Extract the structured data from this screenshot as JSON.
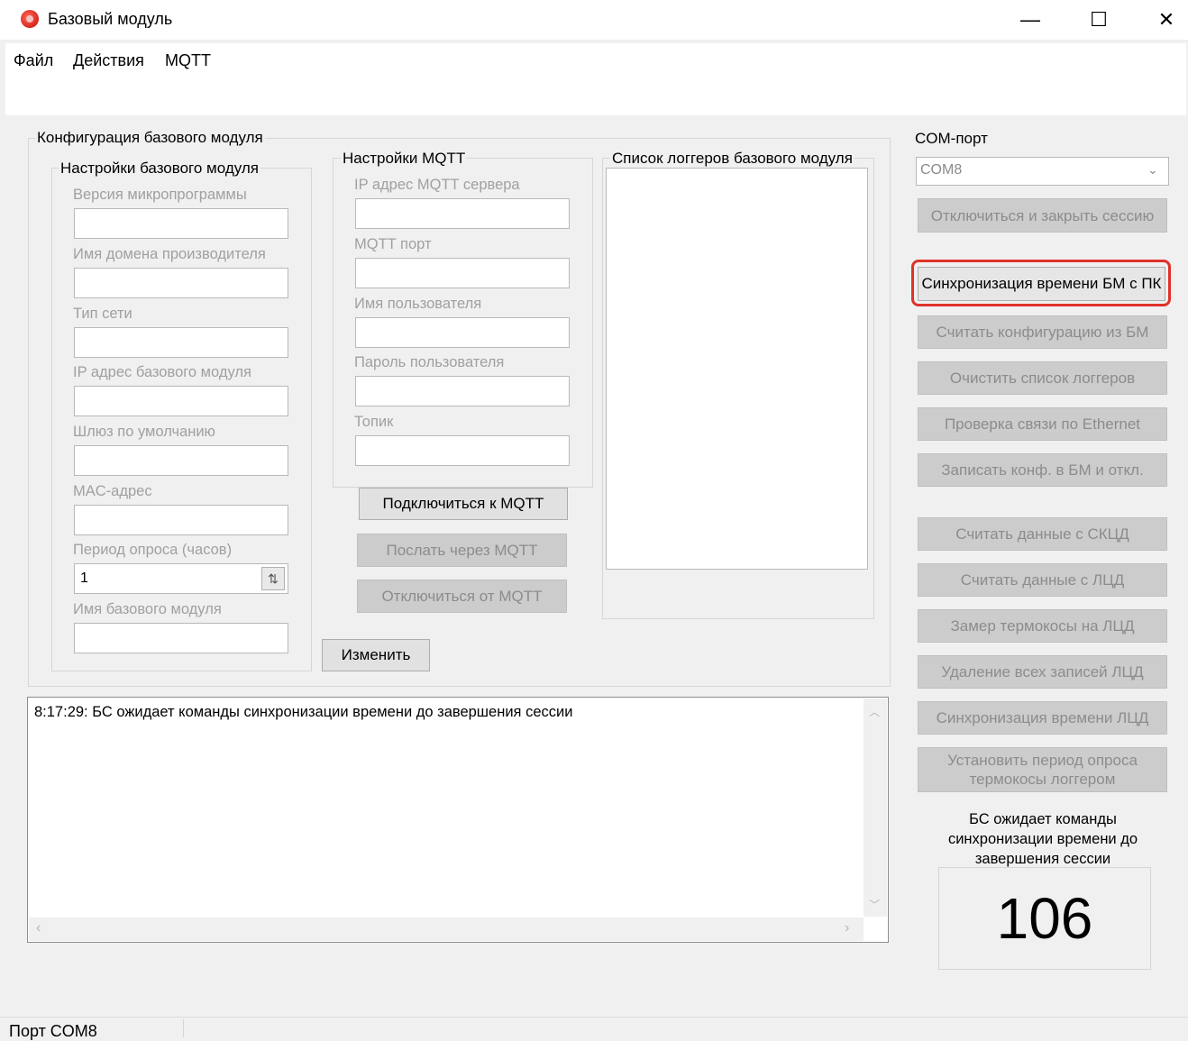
{
  "window": {
    "title": "Базовый модуль",
    "minimize_glyph": "—",
    "maximize_glyph": "☐",
    "close_glyph": "✕"
  },
  "menu": [
    "Файл",
    "Действия",
    "MQTT"
  ],
  "config_group": {
    "title": "Конфигурация базового модуля",
    "settings_title": "Настройки базового модуля",
    "fields": [
      {
        "label": "Версия микропрограммы",
        "value": ""
      },
      {
        "label": "Имя домена производителя",
        "value": ""
      },
      {
        "label": "Тип сети",
        "value": ""
      },
      {
        "label": "IP адрес базового модуля",
        "value": ""
      },
      {
        "label": "Шлюз по умолчанию",
        "value": ""
      },
      {
        "label": "MAC-адрес",
        "value": ""
      },
      {
        "label": "Период опроса (часов)",
        "value": "1"
      },
      {
        "label": "Имя базового модуля",
        "value": ""
      }
    ],
    "edit_button": "Изменить"
  },
  "mqtt_group": {
    "title": "Настройки MQTT",
    "fields": [
      {
        "label": "IP адрес MQTT сервера",
        "value": ""
      },
      {
        "label": "MQTT порт",
        "value": ""
      },
      {
        "label": "Имя пользователя",
        "value": ""
      },
      {
        "label": "Пароль пользователя",
        "value": ""
      },
      {
        "label": "Топик",
        "value": ""
      }
    ],
    "connect_button": "Подключиться к MQTT",
    "send_button": "Послать через MQTT",
    "disconnect_button": "Отключиться от MQTT"
  },
  "loggers_group": {
    "title": "Список логгеров базового модуля"
  },
  "log": {
    "lines": [
      "8:17:29: БС ожидает команды синхронизации времени до завершения сессии"
    ]
  },
  "com": {
    "label": "COM-порт",
    "selected": "COM8",
    "disconnect_button": "Отключиться и закрыть сессию",
    "sync_button": "Синхронизация времени БМ с ПК",
    "buttons_a": [
      "Считать конфигурацию из БМ",
      "Очистить список логгеров",
      "Проверка связи по Ethernet",
      "Записать конф. в БМ и откл."
    ],
    "buttons_b": [
      "Считать данные с СКЦД",
      "Считать данные с ЛЦД",
      "Замер термокосы на ЛЦД",
      "Удаление всех записей ЛЦД",
      "Синхронизация времени ЛЦД",
      "Установить период опроса термокосы логгером"
    ]
  },
  "status_message": "БС ожидает команды синхронизации времени до завершения сессии",
  "counter": "106",
  "statusbar": {
    "port": "Порт COM8"
  },
  "colors": {
    "highlight": "#e0322a"
  }
}
